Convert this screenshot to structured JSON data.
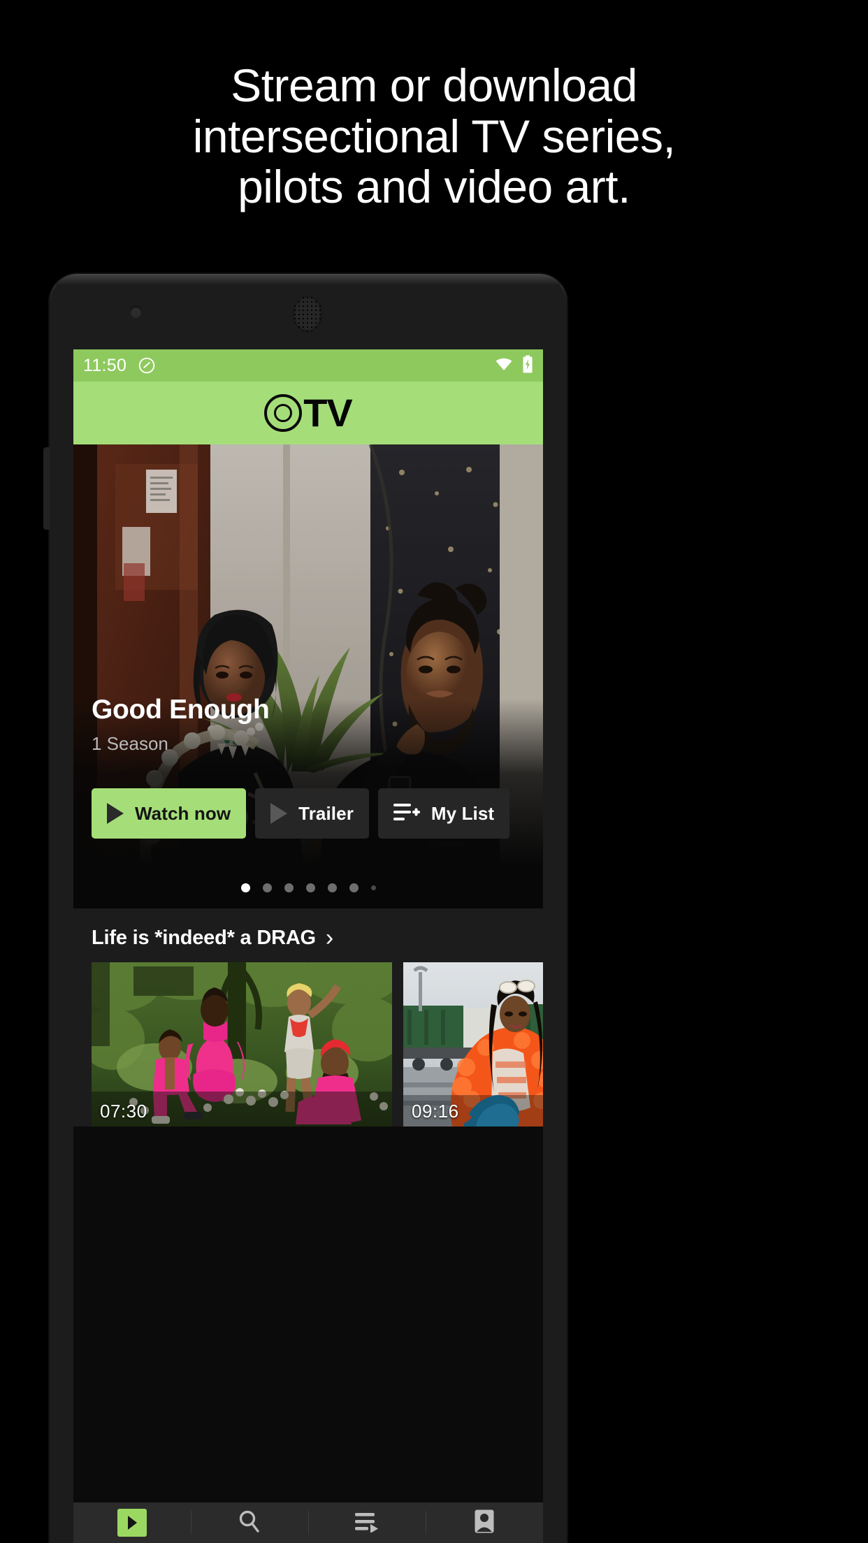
{
  "promo": {
    "headline_lines": [
      "Stream or download",
      "intersectional TV series,",
      "pilots and video art."
    ]
  },
  "colors": {
    "accent_green": "#a5de79",
    "statusbar_green": "#8ec95e",
    "page_background": "#000000",
    "screen_background": "#0b0b0b",
    "section_background": "#1c1c1c",
    "nav_background": "#2b2b2b"
  },
  "device": {
    "front_camera_icon": "camera-icon",
    "earpiece_icon": "speaker-grille-icon"
  },
  "statusbar": {
    "time": "11:50",
    "notification_icon": "no-screenshot-icon",
    "wifi_icon": "wifi-icon",
    "battery_icon": "battery-charging-icon"
  },
  "appbar": {
    "logo_mark": "concentric-circles-icon",
    "logo_text": "TV"
  },
  "hero": {
    "title": "Good Enough",
    "subtitle": "1 Season",
    "image_alt": "two people seated indoors with plants",
    "buttons": [
      {
        "label": "Watch now",
        "icon": "play-icon",
        "style": "primary"
      },
      {
        "label": "Trailer",
        "icon": "play-icon",
        "style": "dark"
      },
      {
        "label": "My List",
        "icon": "playlist-add-icon",
        "style": "dark"
      }
    ],
    "carousel": {
      "total": 7,
      "active_index": 0
    }
  },
  "rows": [
    {
      "title": "Life is *indeed* a DRAG",
      "chevron": "›",
      "items": [
        {
          "duration": "07:30",
          "image_alt": "performers in pink outfits in a garden"
        },
        {
          "duration": "09:16",
          "image_alt": "performer in orange fur coat at a rail yard"
        }
      ]
    }
  ],
  "bottom_nav": [
    {
      "icon": "play-icon",
      "name": "home",
      "active": true
    },
    {
      "icon": "search-icon",
      "name": "search",
      "active": false
    },
    {
      "icon": "queue-icon",
      "name": "my-list",
      "active": false
    },
    {
      "icon": "profile-icon",
      "name": "profile",
      "active": false
    }
  ]
}
